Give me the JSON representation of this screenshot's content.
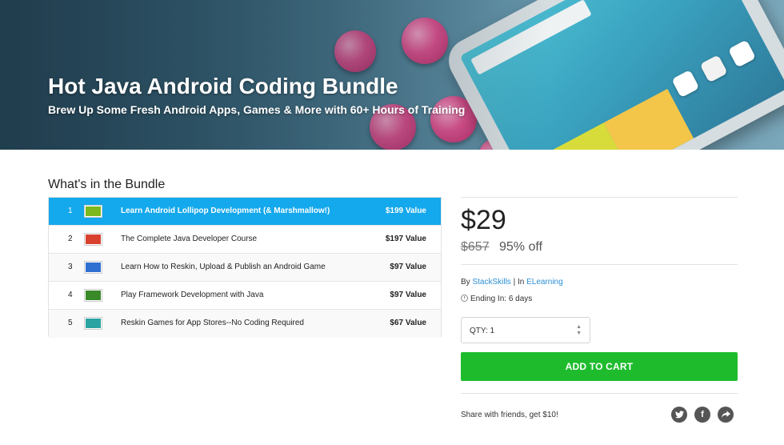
{
  "hero": {
    "title": "Hot Java Android Coding Bundle",
    "subtitle": "Brew Up Some Fresh Android Apps, Games & More with 60+ Hours of Training"
  },
  "bundle": {
    "heading": "What's in the Bundle",
    "items": [
      {
        "num": "1",
        "title": "Learn Android Lollipop Development (& Marshmallow!)",
        "value": "$199 Value",
        "thumb_color": "#7cb81e",
        "active": true
      },
      {
        "num": "2",
        "title": "The Complete Java Developer Course",
        "value": "$197 Value",
        "thumb_color": "#d9412f",
        "active": false
      },
      {
        "num": "3",
        "title": "Learn How to Reskin, Upload & Publish an Android Game",
        "value": "$97 Value",
        "thumb_color": "#2f6fd1",
        "active": false
      },
      {
        "num": "4",
        "title": "Play Framework Development with Java",
        "value": "$97 Value",
        "thumb_color": "#3a8a2a",
        "active": false
      },
      {
        "num": "5",
        "title": "Reskin Games for App Stores--No Coding Required",
        "value": "$67 Value",
        "thumb_color": "#2aa3a3",
        "active": false
      }
    ]
  },
  "purchase": {
    "price": "$29",
    "original_price": "$657",
    "discount": "95% off",
    "by_prefix": "By ",
    "vendor": "StackSkills",
    "separator": " | In ",
    "category": "ELearning",
    "ending": "Ending In: 6 days",
    "qty": "QTY: 1",
    "add_to_cart": "ADD TO CART",
    "share_text": "Share with friends, get $10!"
  },
  "colors": {
    "accent_blue": "#14a8ec",
    "cart_green": "#1ebc2d",
    "link_blue": "#2a8fd6"
  },
  "icons": {
    "twitter": "twitter-icon",
    "facebook": "facebook-icon",
    "share": "share-icon",
    "clock": "clock-icon"
  }
}
